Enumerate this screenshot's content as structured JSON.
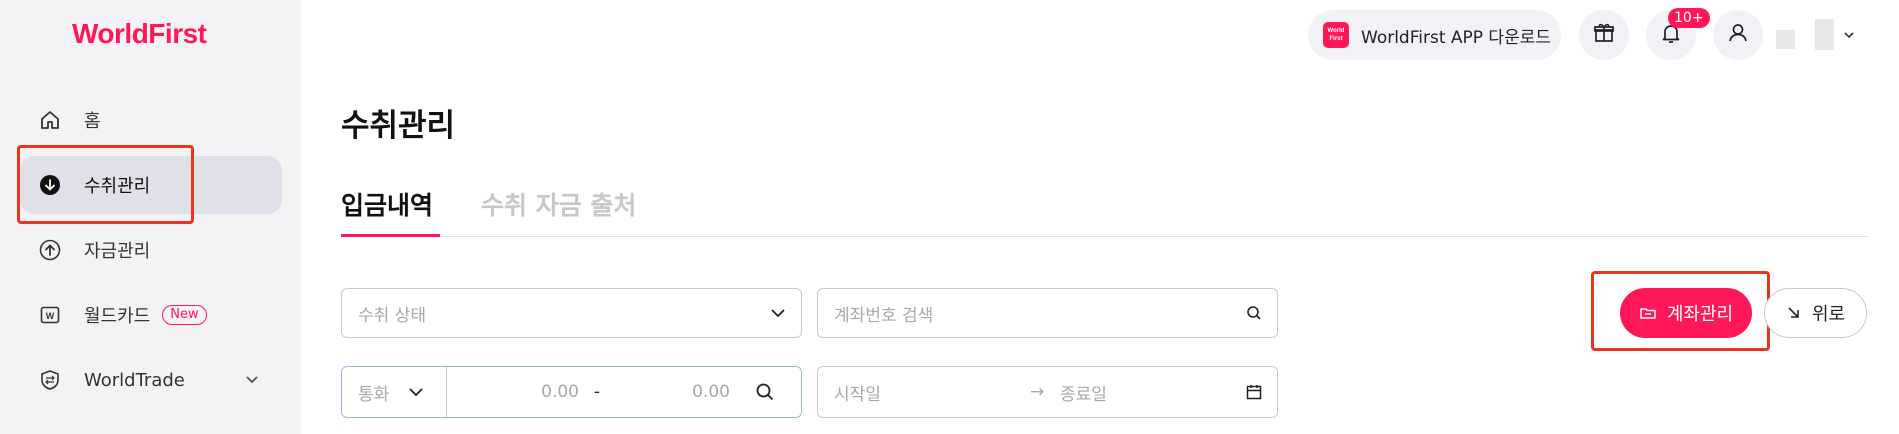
{
  "brand": {
    "logo": "WorldFirst",
    "accent": "#ff1758",
    "highlight": "#e8361e"
  },
  "sidebar": {
    "items": [
      {
        "label": "홈",
        "icon": "home-icon"
      },
      {
        "label": "수취관리",
        "icon": "arrow-down-circle-icon",
        "active": true
      },
      {
        "label": "자금관리",
        "icon": "arrow-up-circle-icon"
      },
      {
        "label": "월드카드",
        "icon": "card-w-icon",
        "badge": "New"
      },
      {
        "label": "WorldTrade",
        "icon": "shield-icon",
        "expandable": true
      }
    ]
  },
  "header": {
    "app_download_label": "WorldFirst APP 다운로드",
    "app_logo_text": "World First",
    "notification_count": "10+"
  },
  "main": {
    "title": "수취관리",
    "tabs": [
      {
        "label": "입금내역",
        "active": true
      },
      {
        "label": "수취 자금 출처",
        "active": false
      }
    ],
    "filters": {
      "status_placeholder": "수취 상태",
      "account_search_placeholder": "계좌번호 검색",
      "currency_placeholder": "통화",
      "amount_min": "0.00",
      "amount_separator": "-",
      "amount_max": "0.00",
      "start_date_placeholder": "시작일",
      "date_arrow": "→",
      "end_date_placeholder": "종료일"
    },
    "buttons": {
      "account_manage": "계좌관리",
      "move_up": "위로"
    }
  }
}
